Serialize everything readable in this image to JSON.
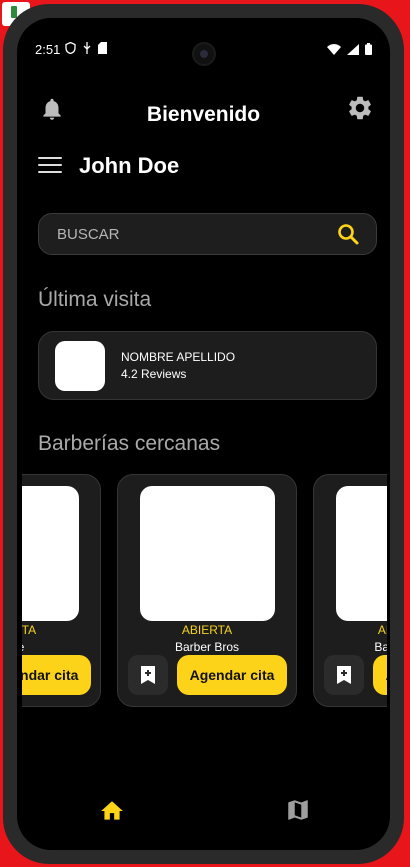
{
  "status": {
    "time": "2:51",
    "left_icons": [
      "shield-icon",
      "usb-icon",
      "sd-card-icon"
    ],
    "right_icons": [
      "wifi-icon",
      "signal-icon",
      "battery-icon"
    ]
  },
  "header": {
    "title": "Bienvenido",
    "bell_icon": "bell-icon",
    "gear_icon": "gear-icon"
  },
  "user": {
    "name": "John Doe",
    "menu_icon": "menu-icon"
  },
  "search": {
    "placeholder": "BUSCAR",
    "icon": "search-icon"
  },
  "sections": {
    "last_visit": "Última visita",
    "nearby": "Barberías cercanas"
  },
  "last_visit": {
    "name": "NOMBRE APELLIDO",
    "reviews": "4.2 Reviews"
  },
  "shops": [
    {
      "status": "ABIERTA",
      "name": "Style",
      "action": "Agendar cita"
    },
    {
      "status": "ABIERTA",
      "name": "Barber Bros",
      "action": "Agendar cita"
    },
    {
      "status": "ABIERTA",
      "name": "Barbería P",
      "action": "Agendar cita"
    }
  ],
  "bottom_nav": {
    "home_icon": "home-icon",
    "map_icon": "map-icon"
  },
  "colors": {
    "accent": "#fdd31a",
    "background": "#000000",
    "card": "#1d1d1d"
  }
}
